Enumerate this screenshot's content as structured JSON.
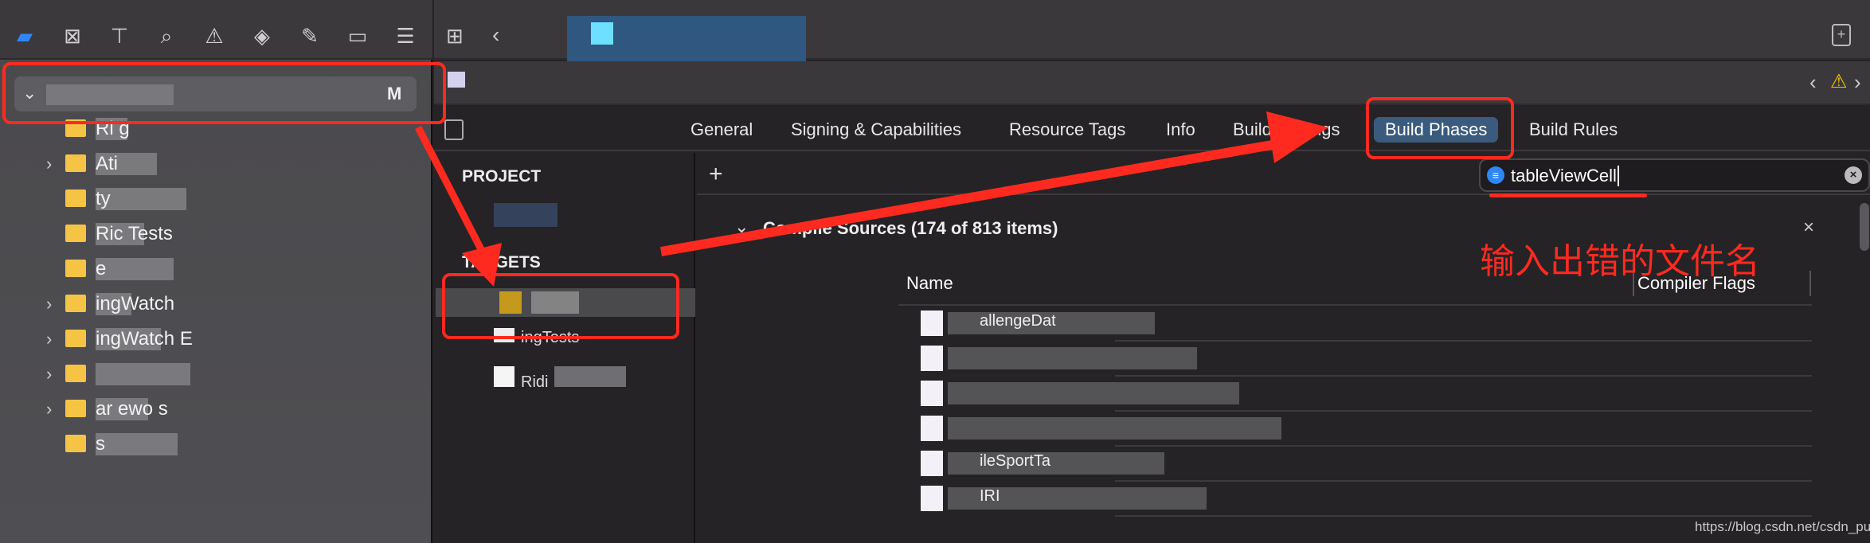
{
  "navigator": {
    "tab_icons": [
      "folder-icon",
      "source-control-icon",
      "hierarchy-icon",
      "search-icon",
      "warning-icon",
      "test-icon",
      "debug-icon",
      "breakpoint-icon",
      "report-icon"
    ],
    "root_badge": "M",
    "items": [
      {
        "label": "Ri   g",
        "disclosure": ""
      },
      {
        "label": "Ati",
        "disclosure": "›"
      },
      {
        "label": "   ty",
        "disclosure": ""
      },
      {
        "label": "Ric   Tests",
        "disclosure": ""
      },
      {
        "label": "    e",
        "disclosure": ""
      },
      {
        "label": "ingWatch",
        "disclosure": "›"
      },
      {
        "label": "  ingWatch E",
        "disclosure": "›"
      },
      {
        "label": "",
        "disclosure": "›"
      },
      {
        "label": "ar  ewo  s",
        "disclosure": "›"
      },
      {
        "label": "   s",
        "disclosure": ""
      }
    ]
  },
  "tabs": [
    "General",
    "Signing & Capabilities",
    "Resource Tags",
    "Info",
    "Build Settings",
    "Build Phases",
    "Build Rules"
  ],
  "selected_tab": "Build Phases",
  "project_pane": {
    "project_header": "PROJECT",
    "targets_header": "TARGETS",
    "targets": [
      "",
      "ingTests",
      "Ridi"
    ]
  },
  "toolbar": {
    "add_label": "+"
  },
  "filter": {
    "value": "tableViewCell"
  },
  "phase": {
    "title": "Compile Sources (174 of 813 items)",
    "columns": [
      "Name",
      "Compiler Flags"
    ],
    "rows": [
      "allengeDat",
      "",
      "",
      "",
      "ileSportTa",
      "IRI"
    ]
  },
  "annotation": "输入出错的文件名",
  "watermark": "https://blog.csdn.net/csdn_pun",
  "colors": {
    "accent": "#2f87f5",
    "annotation_red": "#ff2a1f",
    "selected_tab": "#3a5b7d",
    "warning": "#f5c400"
  }
}
